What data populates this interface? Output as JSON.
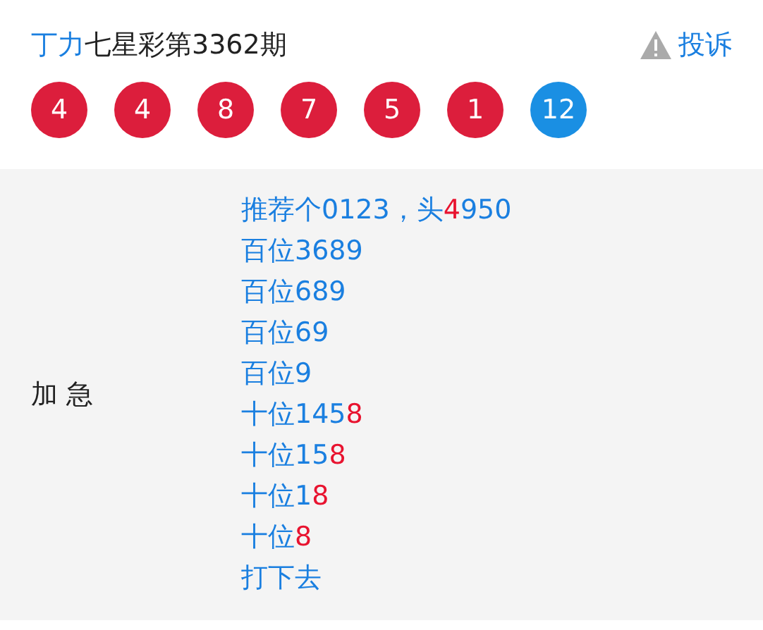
{
  "header": {
    "author": "丁力",
    "title": "七星彩第3362期",
    "complaint": "投诉"
  },
  "balls": [
    {
      "number": "4",
      "kind": "red"
    },
    {
      "number": "4",
      "kind": "red"
    },
    {
      "number": "8",
      "kind": "red"
    },
    {
      "number": "7",
      "kind": "red"
    },
    {
      "number": "5",
      "kind": "red"
    },
    {
      "number": "1",
      "kind": "red"
    },
    {
      "number": "12",
      "kind": "blue"
    }
  ],
  "detail": {
    "label": "加 急",
    "lines": [
      [
        {
          "text": "推荐个0123，头",
          "highlight": false
        },
        {
          "text": "4",
          "highlight": true
        },
        {
          "text": "950",
          "highlight": false
        }
      ],
      [
        {
          "text": "百位3689",
          "highlight": false
        }
      ],
      [
        {
          "text": "百位689",
          "highlight": false
        }
      ],
      [
        {
          "text": "百位69",
          "highlight": false
        }
      ],
      [
        {
          "text": "百位9",
          "highlight": false
        }
      ],
      [
        {
          "text": "十位145",
          "highlight": false
        },
        {
          "text": "8",
          "highlight": true
        }
      ],
      [
        {
          "text": "十位15",
          "highlight": false
        },
        {
          "text": "8",
          "highlight": true
        }
      ],
      [
        {
          "text": "十位1",
          "highlight": false
        },
        {
          "text": "8",
          "highlight": true
        }
      ],
      [
        {
          "text": "十位",
          "highlight": false
        },
        {
          "text": "8",
          "highlight": true
        }
      ],
      [
        {
          "text": "打下去",
          "highlight": false
        }
      ]
    ]
  }
}
